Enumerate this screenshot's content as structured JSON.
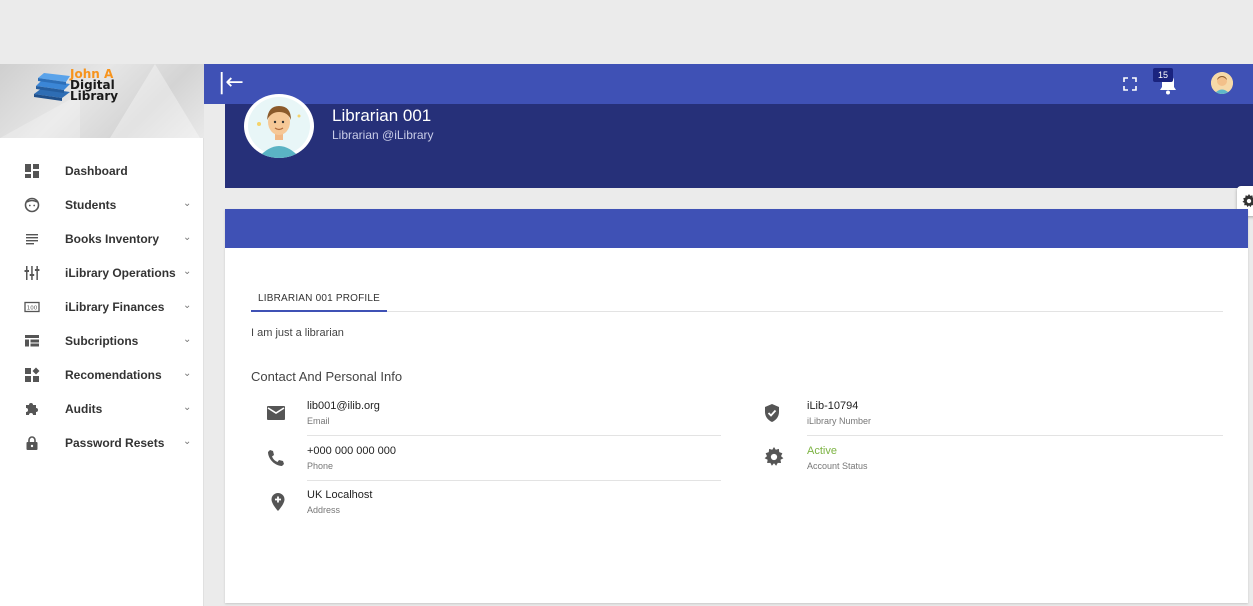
{
  "logo": {
    "line1": "John A",
    "line2": "Digital",
    "line3": "Library"
  },
  "sidebar": {
    "items": [
      {
        "label": "Dashboard",
        "icon": "dashboard-icon",
        "has_chevron": false
      },
      {
        "label": "Students",
        "icon": "face-icon",
        "has_chevron": true
      },
      {
        "label": "Books Inventory",
        "icon": "list-icon",
        "has_chevron": true
      },
      {
        "label": "iLibrary Operations",
        "icon": "operations-icon",
        "has_chevron": true
      },
      {
        "label": "iLibrary Finances",
        "icon": "finances-icon",
        "has_chevron": true
      },
      {
        "label": "Subcriptions",
        "icon": "subscriptions-icon",
        "has_chevron": true
      },
      {
        "label": "Recomendations",
        "icon": "recommendations-icon",
        "has_chevron": true
      },
      {
        "label": "Audits",
        "icon": "puzzle-icon",
        "has_chevron": true
      },
      {
        "label": "Password Resets",
        "icon": "lock-icon",
        "has_chevron": true
      }
    ]
  },
  "topbar": {
    "collapse_glyph": "|←",
    "notification_count": "15"
  },
  "profile": {
    "name": "Librarian 001",
    "handle": "Librarian @iLibrary"
  },
  "card": {
    "tab_label": "LIBRARIAN 001 PROFILE",
    "bio": "I am just a librarian",
    "section_title": "Contact And Personal Info",
    "info": {
      "email": {
        "value": "lib001@ilib.org",
        "label": "Email"
      },
      "phone": {
        "value": "+000 000 000 000",
        "label": "Phone"
      },
      "address": {
        "value": "UK Localhost",
        "label": "Address"
      },
      "library_number": {
        "value": "iLib-10794",
        "label": "iLibrary Number"
      },
      "account_status": {
        "value": "Active",
        "label": "Account Status"
      }
    }
  },
  "colors": {
    "primary": "#3f51b5",
    "header_dark": "#263079",
    "status_active": "#7cb342",
    "logo_orange": "#f7941d"
  }
}
